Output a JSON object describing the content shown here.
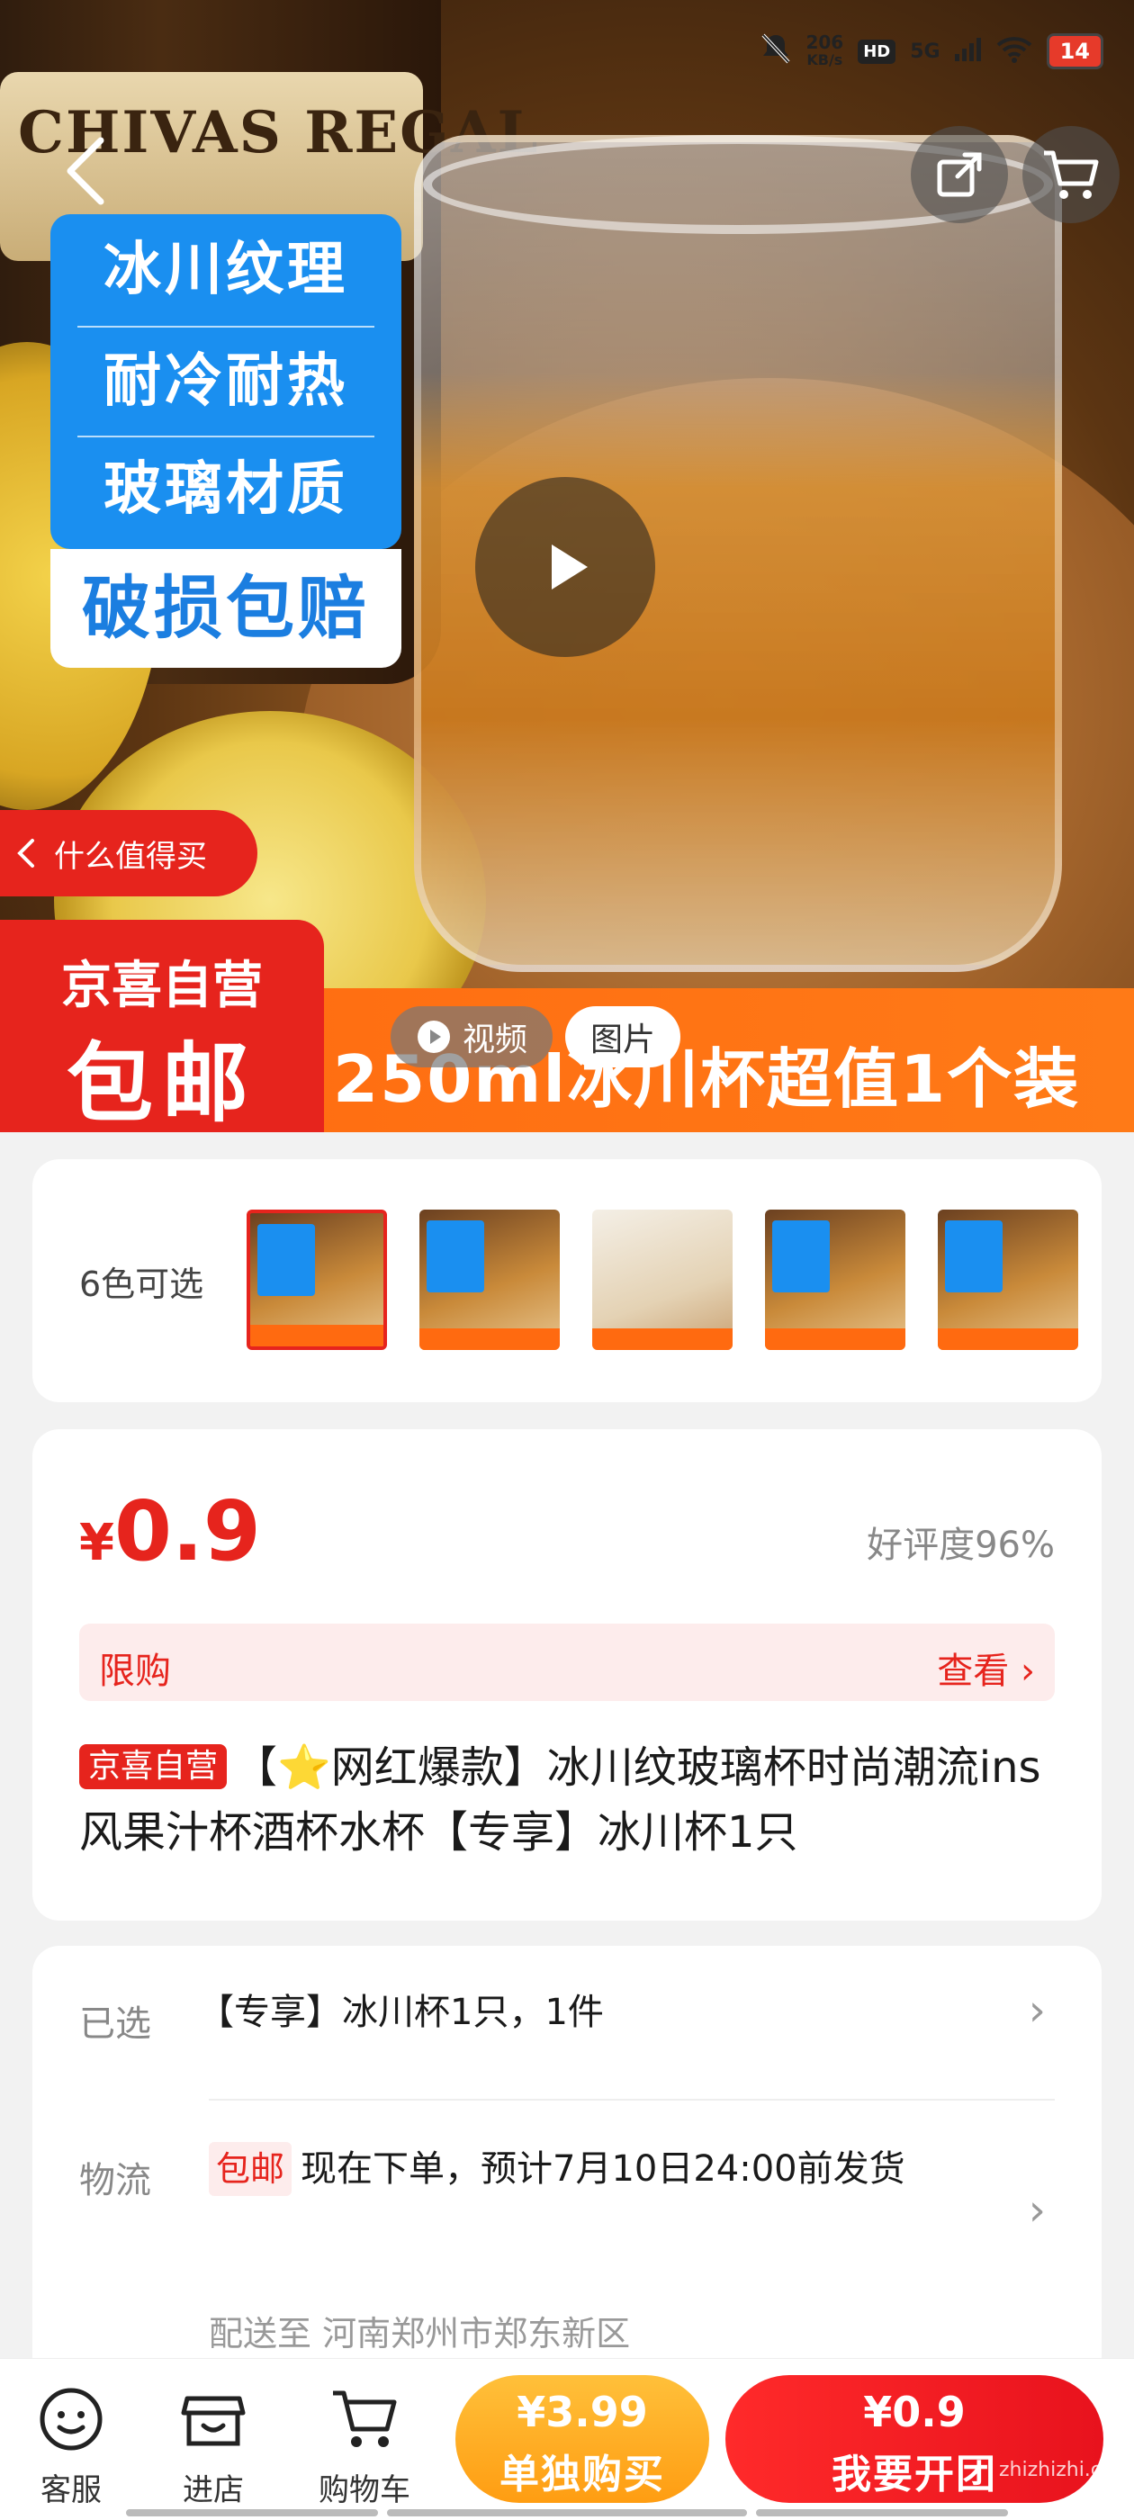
{
  "status_bar": {
    "speed": "206",
    "speed_unit": "KB/s",
    "hd": "HD",
    "network": "5G",
    "battery": "14"
  },
  "hero": {
    "bottle_text": "CHIVAS REGAL",
    "features": [
      "冰川纹理",
      "耐冷耐热",
      "玻璃材质"
    ],
    "guarantee": "破损包赔",
    "worth_buy": "什么值得买",
    "promo_top": "京喜自营",
    "promo_bottom": "包邮",
    "promo_text": "250ml冰川杯超值1个装",
    "tab_video": "视频",
    "tab_picture": "图片"
  },
  "colors": {
    "label": "6色可选"
  },
  "price_card": {
    "currency": "¥",
    "price": "0.9",
    "rating": "好评度96%",
    "limit_label": "限购",
    "limit_action": "查看 ›",
    "badge": "京喜自营",
    "title": "【⭐网红爆款】冰川纹玻璃杯时尚潮流ins风果汁杯酒杯水杯【专享】冰川杯1只"
  },
  "info": {
    "selected_label": "已选",
    "selected_value": "【专享】冰川杯1只，1件",
    "logistics_label": "物流",
    "shipping_badge": "包邮",
    "logistics_value": "现在下单，预计7月10日24:00前发货",
    "destination": "配送至  河南郑州市郑东新区"
  },
  "bottom_bar": {
    "service": "客服",
    "store": "进店",
    "cart": "购物车",
    "solo_price": "¥3.99",
    "solo_label": "单独购买",
    "group_price": "¥0.9",
    "group_label": "我要开团"
  },
  "watermark": "zhizhizhi.com",
  "colors_palette": {
    "accent_red": "#e6241d",
    "promo_orange": "#ff6a10",
    "feature_blue": "#1a8ff0",
    "solo_button": "#ff9d12"
  }
}
